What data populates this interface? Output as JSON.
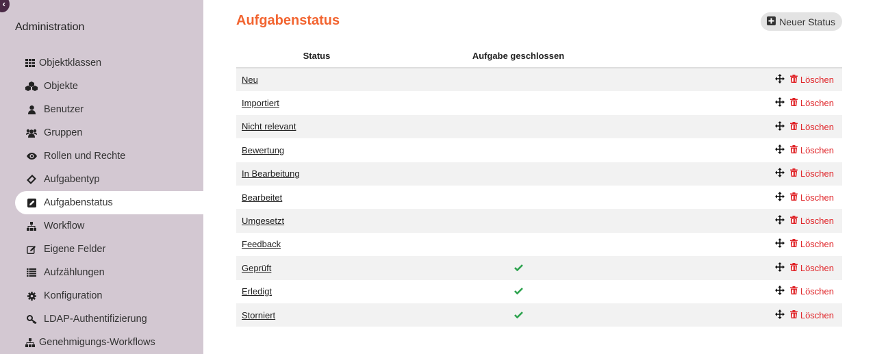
{
  "sidebar": {
    "collapse_icon": "chevron-left-icon",
    "title": "Administration",
    "items": [
      {
        "label": "Objektklassen",
        "icon": "th-grid-icon",
        "active": false
      },
      {
        "label": "Objekte",
        "icon": "cubes-icon",
        "active": false
      },
      {
        "label": "Benutzer",
        "icon": "user-icon",
        "active": false
      },
      {
        "label": "Gruppen",
        "icon": "users-icon",
        "active": false
      },
      {
        "label": "Rollen und Rechte",
        "icon": "eye-icon",
        "active": false
      },
      {
        "label": "Aufgabentyp",
        "icon": "ticket-icon",
        "active": false
      },
      {
        "label": "Aufgabenstatus",
        "icon": "pencil-square-icon",
        "active": true
      },
      {
        "label": "Workflow",
        "icon": "sitemap-icon",
        "active": false
      },
      {
        "label": "Eigene Felder",
        "icon": "edit-icon",
        "active": false
      },
      {
        "label": "Aufzählungen",
        "icon": "list-icon",
        "active": false
      },
      {
        "label": "Konfiguration",
        "icon": "cog-icon",
        "active": false
      },
      {
        "label": "LDAP-Authentifizierung",
        "icon": "key-icon",
        "active": false
      },
      {
        "label": "Genehmigungs-Workflows",
        "icon": "sitemap-icon",
        "active": false
      }
    ]
  },
  "main": {
    "title": "Aufgabenstatus",
    "new_button": {
      "label": "Neuer Status",
      "icon": "plus-square-icon"
    },
    "table": {
      "columns": [
        "Status",
        "Aufgabe geschlossen",
        ""
      ],
      "rows": [
        {
          "name": "Neu",
          "closed": false
        },
        {
          "name": "Importiert",
          "closed": false
        },
        {
          "name": "Nicht relevant",
          "closed": false
        },
        {
          "name": "Bewertung",
          "closed": false
        },
        {
          "name": "In Bearbeitung",
          "closed": false
        },
        {
          "name": "Bearbeitet",
          "closed": false
        },
        {
          "name": "Umgesetzt",
          "closed": false
        },
        {
          "name": "Feedback",
          "closed": false
        },
        {
          "name": "Geprüft",
          "closed": true
        },
        {
          "name": "Erledigt",
          "closed": true
        },
        {
          "name": "Storniert",
          "closed": true
        }
      ],
      "delete_label": "Löschen"
    },
    "colors": {
      "accent": "#f26430",
      "delete": "#e0262a",
      "check": "#2ea34f",
      "sidebar_bg": "#d3c8d2"
    }
  }
}
